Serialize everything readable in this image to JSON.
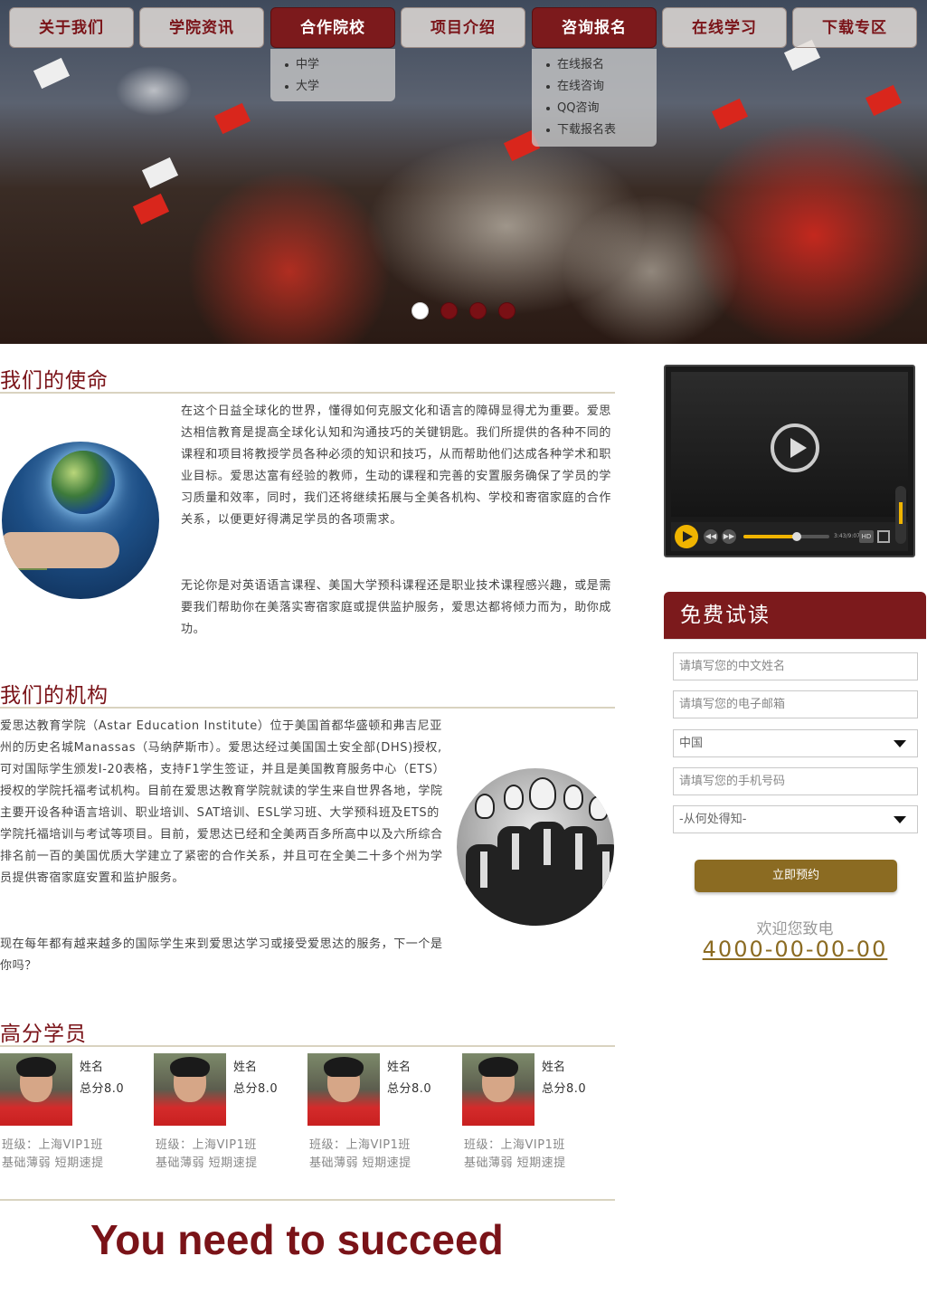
{
  "nav": {
    "items": [
      {
        "label": "关于我们"
      },
      {
        "label": "学院资讯"
      },
      {
        "label": "合作院校"
      },
      {
        "label": "项目介绍"
      },
      {
        "label": "咨询报名"
      },
      {
        "label": "在线学习"
      },
      {
        "label": "下载专区"
      }
    ],
    "dropdown_schools": [
      "中学",
      "大学"
    ],
    "dropdown_consult": [
      "在线报名",
      "在线咨询",
      "QQ咨询",
      "下载报名表"
    ]
  },
  "mission": {
    "title": "我们的使命",
    "p1": "在这个日益全球化的世界，懂得如何克服文化和语言的障碍显得尤为重要。爱思达相信教育是提高全球化认知和沟通技巧的关键钥匙。我们所提供的各种不同的课程和项目将教授学员各种必须的知识和技巧，从而帮助他们达成各种学术和职业目标。爱思达富有经验的教师，生动的课程和完善的安置服务确保了学员的学习质量和效率，同时，我们还将继续拓展与全美各机构、学校和寄宿家庭的合作关系，以便更好得满足学员的各项需求。",
    "p2": "无论你是对英语语言课程、美国大学预科课程还是职业技术课程感兴趣，或是需要我们帮助你在美落实寄宿家庭或提供监护服务，爱思达都将倾力而为，助你成功。"
  },
  "institution": {
    "title": "我们的机构",
    "p1": "爱思达教育学院（Astar Education Institute）位于美国首都华盛顿和弗吉尼亚州的历史名城Manassas（马纳萨斯市）。爱思达经过美国国土安全部(DHS)授权, 可对国际学生颁发I-20表格，支持F1学生签证，并且是美国教育服务中心（ETS）授权的学院托福考试机构。目前在爱思达教育学院就读的学生来自世界各地，学院主要开设各种语言培训、职业培训、SAT培训、ESL学习班、大学预科班及ETS的学院托福培训与考试等项目。目前，爱思达已经和全美两百多所高中以及六所综合排名前一百的美国优质大学建立了紧密的合作关系，并且可在全美二十多个州为学员提供寄宿家庭安置和监护服务。",
    "p2": "现在每年都有越来越多的国际学生来到爱思达学习或接受爱思达的服务，下一个是你吗？"
  },
  "students": {
    "title": "高分学员",
    "items": [
      {
        "name": "姓名",
        "score": "总分8.0",
        "cls": "班级：上海VIP1班",
        "tags": "基础薄弱 短期速提"
      },
      {
        "name": "姓名",
        "score": "总分8.0",
        "cls": "班级：上海VIP1班",
        "tags": "基础薄弱 短期速提"
      },
      {
        "name": "姓名",
        "score": "总分8.0",
        "cls": "班级：上海VIP1班",
        "tags": "基础薄弱 短期速提"
      },
      {
        "name": "姓名",
        "score": "总分8.0",
        "cls": "班级：上海VIP1班",
        "tags": "基础薄弱 短期速提"
      }
    ]
  },
  "slogan": "You need to succeed",
  "video": {
    "progress": 0.62,
    "time": "3:43/9:07",
    "hd_label": "HD"
  },
  "form": {
    "title": "免费试读",
    "name_placeholder": "请填写您的中文姓名",
    "email_placeholder": "请填写您的电子邮箱",
    "country_value": "中国",
    "phone_placeholder": "请填写您的手机号码",
    "source_value": "-从何处得知-",
    "submit_label": "立即预约",
    "welcome": "欢迎您致电",
    "phone": "4000-00-00-00"
  },
  "colors": {
    "brand": "#7a1318",
    "accent": "#8b6b22"
  }
}
